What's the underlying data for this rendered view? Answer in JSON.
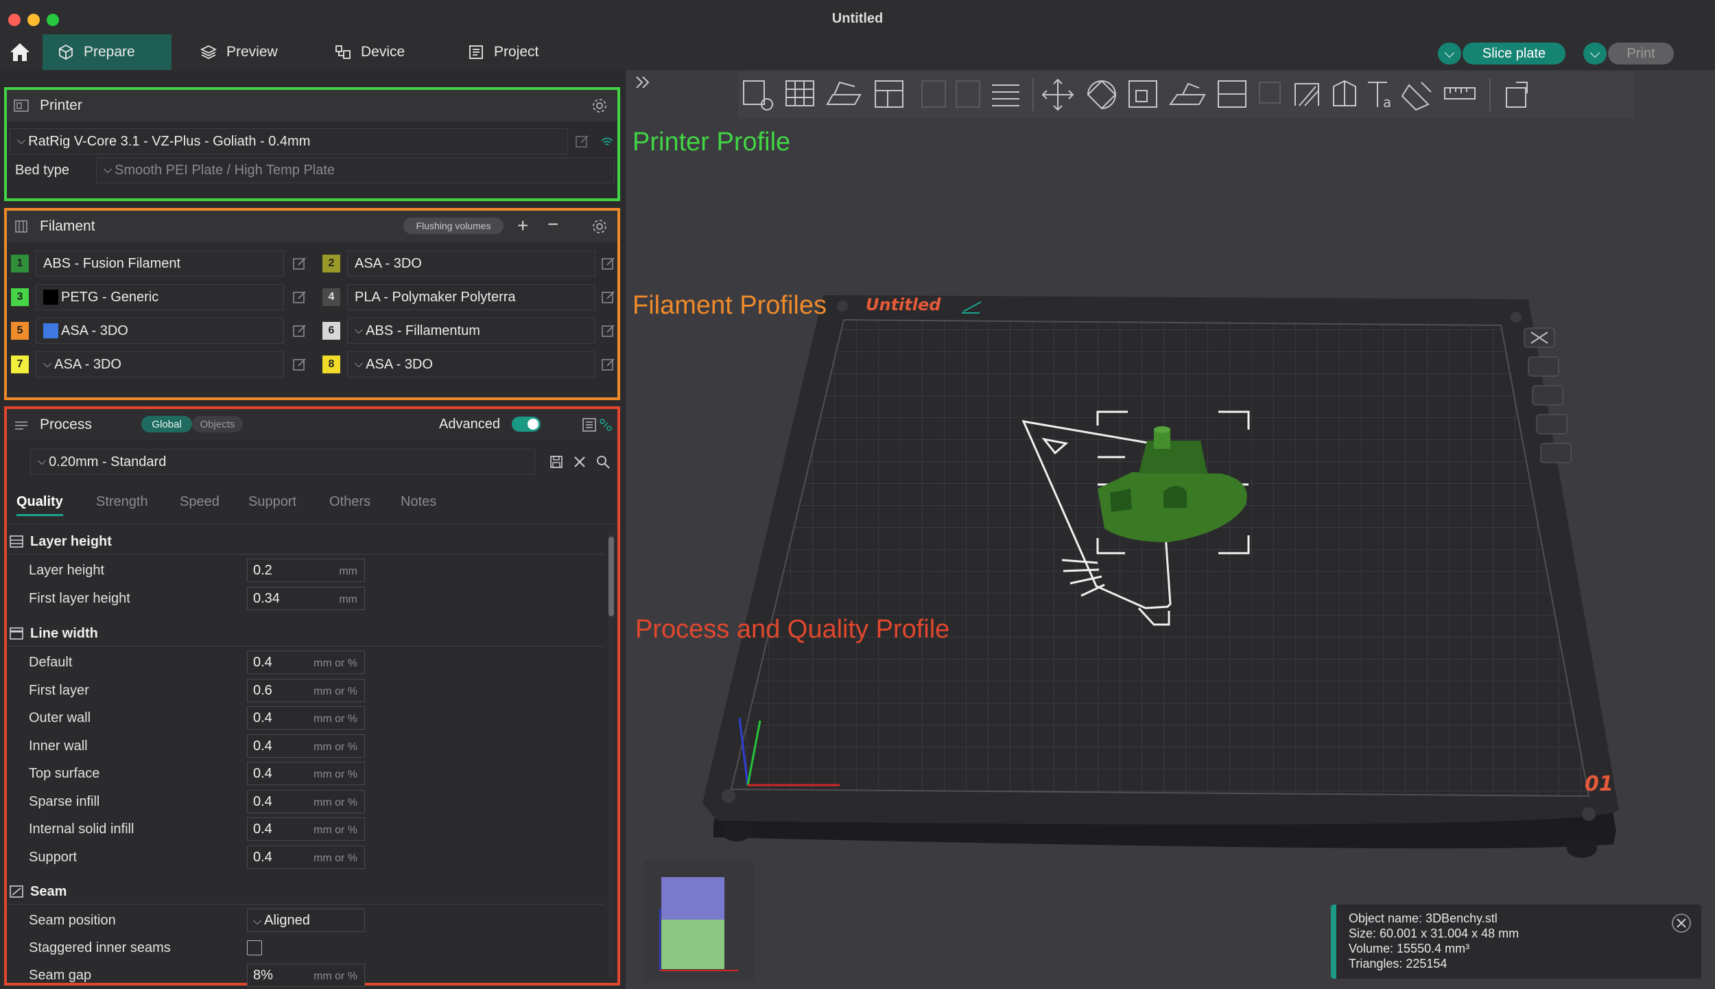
{
  "window": {
    "title": "Untitled"
  },
  "tabs": {
    "prepare": "Prepare",
    "preview": "Preview",
    "device": "Device",
    "project": "Project"
  },
  "actions": {
    "slice": "Slice plate",
    "print": "Print"
  },
  "printer": {
    "title": "Printer",
    "profile": "RatRig V-Core 3.1 - VZ-Plus - Goliath - 0.4mm",
    "bed_type_label": "Bed type",
    "bed_type": "Smooth PEI Plate / High Temp Plate"
  },
  "filament": {
    "title": "Filament",
    "flushing": "Flushing volumes",
    "items": [
      {
        "num": "1",
        "name": "ABS - Fusion Filament",
        "color": "#2f8f3a"
      },
      {
        "num": "2",
        "name": "ASA - 3DO",
        "color": "#9a9a2a"
      },
      {
        "num": "3",
        "name": "PETG - Generic",
        "color": "#47d447"
      },
      {
        "num": "4",
        "name": "PLA - Polymaker Polyterra",
        "color": "#4a4a4a"
      },
      {
        "num": "5",
        "name": "ASA - 3DO",
        "color": "#f08c2c"
      },
      {
        "num": "6",
        "name": "ABS - Fillamentum",
        "color": "#d8d8d8"
      },
      {
        "num": "7",
        "name": "ASA - 3DO",
        "color": "#f3ee3c"
      },
      {
        "num": "8",
        "name": "ASA - 3DO",
        "color": "#f0dc28"
      }
    ]
  },
  "process": {
    "title": "Process",
    "global": "Global",
    "objects": "Objects",
    "advanced": "Advanced",
    "profile": "0.20mm - Standard",
    "tabs": [
      "Quality",
      "Strength",
      "Speed",
      "Support",
      "Others",
      "Notes"
    ],
    "layer_height_group": "Layer height",
    "line_width_group": "Line width",
    "seam_group": "Seam",
    "rows": {
      "layer_height": {
        "label": "Layer height",
        "value": "0.2",
        "unit": "mm"
      },
      "first_layer_height": {
        "label": "First layer height",
        "value": "0.34",
        "unit": "mm"
      },
      "default": {
        "label": "Default",
        "value": "0.4",
        "unit": "mm or %"
      },
      "first_layer": {
        "label": "First layer",
        "value": "0.6",
        "unit": "mm or %"
      },
      "outer_wall": {
        "label": "Outer wall",
        "value": "0.4",
        "unit": "mm or %"
      },
      "inner_wall": {
        "label": "Inner wall",
        "value": "0.4",
        "unit": "mm or %"
      },
      "top_surface": {
        "label": "Top surface",
        "value": "0.4",
        "unit": "mm or %"
      },
      "sparse_infill": {
        "label": "Sparse infill",
        "value": "0.4",
        "unit": "mm or %"
      },
      "internal_solid_infill": {
        "label": "Internal solid infill",
        "value": "0.4",
        "unit": "mm or %"
      },
      "support": {
        "label": "Support",
        "value": "0.4",
        "unit": "mm or %"
      },
      "seam_position": {
        "label": "Seam position",
        "value": "Aligned"
      },
      "staggered": {
        "label": "Staggered inner seams"
      },
      "seam_gap": {
        "label": "Seam gap",
        "value": "8%",
        "unit": "mm or %"
      }
    }
  },
  "annotations": {
    "printer": "Printer Profile",
    "filament": "Filament Profiles",
    "process": "Process and Quality Profile"
  },
  "plate": {
    "name": "Untitled",
    "number": "01"
  },
  "object_info": {
    "name": "Object name: 3DBenchy.stl",
    "size": "Size: 60.001 x 31.004 x 48 mm",
    "volume": "Volume: 15550.4 mm³",
    "triangles": "Triangles: 225154"
  },
  "colors": {
    "accent": "#168472",
    "printer_box": "#42d544",
    "filament_box": "#ef8a2a",
    "process_box": "#e2472e",
    "model": "#3f8a2a"
  }
}
